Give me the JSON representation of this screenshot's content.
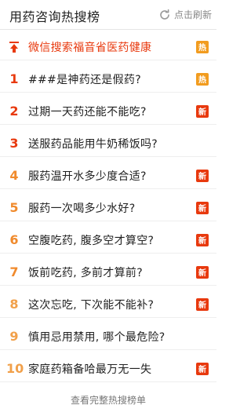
{
  "header": {
    "title": "用药咨询热搜榜",
    "refresh_label": "点击刷新"
  },
  "pinned": {
    "text": "微信搜索福音省医药健康",
    "badge": "热"
  },
  "items": [
    {
      "rank": "1",
      "text": "###是神药还是假药?",
      "badge": "热",
      "badge_type": "hot"
    },
    {
      "rank": "2",
      "text": "过期一天药还能不能吃?",
      "badge": "新",
      "badge_type": "new"
    },
    {
      "rank": "3",
      "text": "送服药品能用牛奶稀饭吗?",
      "badge": "",
      "badge_type": ""
    },
    {
      "rank": "4",
      "text": "服药温开水多少度合适?",
      "badge": "新",
      "badge_type": "new"
    },
    {
      "rank": "5",
      "text": "服药一次喝多少水好?",
      "badge": "新",
      "badge_type": "new"
    },
    {
      "rank": "6",
      "text": "空腹吃药, 腹多空才算空?",
      "badge": "新",
      "badge_type": "new"
    },
    {
      "rank": "7",
      "text": "饭前吃药, 多前才算前?",
      "badge": "新",
      "badge_type": "new"
    },
    {
      "rank": "8",
      "text": "这次忘吃, 下次能不能补?",
      "badge": "新",
      "badge_type": "new"
    },
    {
      "rank": "9",
      "text": "慎用忌用禁用, 哪个最危险?",
      "badge": "",
      "badge_type": ""
    },
    {
      "rank": "10",
      "text": "家庭药箱备哈最万无一失",
      "badge": "新",
      "badge_type": "new"
    }
  ],
  "footer": {
    "label": "查看完整热搜榜单"
  },
  "colors": {
    "pinned_red": "#e8390e",
    "rank_orange": "#f08a2c",
    "badge_hot": "#f29c1f",
    "badge_new": "#e8390e"
  }
}
